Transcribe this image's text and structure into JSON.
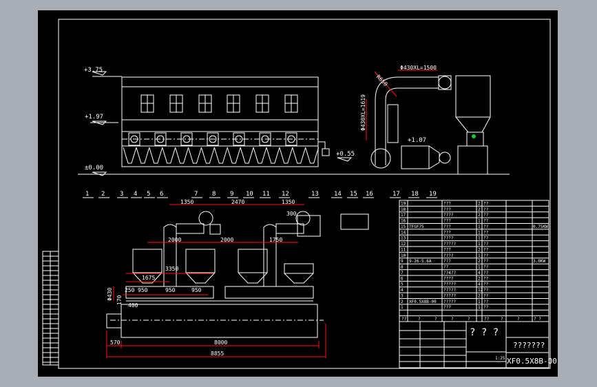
{
  "colors": {
    "background": "#a9adb5",
    "paper": "#000000",
    "line": "#ffffff",
    "dimension": "#ff1010",
    "marker": "#00cc33"
  },
  "elevations": {
    "top": "+3.75",
    "mid": "+1.97",
    "ground": "±0.00",
    "outlet": "+0.55",
    "fan": "+1.07"
  },
  "callouts": [
    "1",
    "2",
    "3",
    "4",
    "5",
    "6",
    "7",
    "8",
    "9",
    "10",
    "11",
    "12",
    "13",
    "14",
    "15",
    "16",
    "17",
    "18",
    "19"
  ],
  "side_view": {
    "duct_h": "Φ430XL=1500",
    "duct_v": "Φ430XL=1619",
    "bend": "R650"
  },
  "plan_dims": {
    "d1350a": "1350",
    "d2470": "2470",
    "d1350b": "1350",
    "d300": "300",
    "d2000a": "2000",
    "d2000b": "2000",
    "d1750": "1750",
    "d3350": "3350",
    "d1675": "1675",
    "d250": "250",
    "d950a": "950",
    "d950b": "950",
    "d950c": "950",
    "d430": "Φ430",
    "d170": "170",
    "d400": "400",
    "d570": "570",
    "d8000": "8000",
    "d8855": "8855"
  },
  "parts_list": [
    {
      "no": "19",
      "code": "",
      "name": "???",
      "qty": "2",
      "mat": "??",
      "note": ""
    },
    {
      "no": "18",
      "code": "",
      "name": "???",
      "qty": "2",
      "mat": "??",
      "note": ""
    },
    {
      "no": "17",
      "code": "",
      "name": "????",
      "qty": "2",
      "mat": "??",
      "note": ""
    },
    {
      "no": "16",
      "code": "",
      "name": "???",
      "qty": "1",
      "mat": "??",
      "note": ""
    },
    {
      "no": "15",
      "code": "TFGF75",
      "name": "???",
      "qty": "1",
      "mat": "??",
      "note": "0.75KW"
    },
    {
      "no": "14",
      "code": "",
      "name": "???",
      "qty": "1",
      "mat": "??",
      "note": ""
    },
    {
      "no": "13",
      "code": "",
      "name": "????",
      "qty": "1",
      "mat": "??",
      "note": ""
    },
    {
      "no": "12",
      "code": "",
      "name": "?????",
      "qty": "1",
      "mat": "??",
      "note": ""
    },
    {
      "no": "11",
      "code": "",
      "name": "???",
      "qty": "2",
      "mat": "??",
      "note": ""
    },
    {
      "no": "10",
      "code": "",
      "name": "????",
      "qty": "1",
      "mat": "??",
      "note": ""
    },
    {
      "no": "9",
      "code": "9-26-5.6A",
      "name": "???",
      "qty": "2",
      "mat": "??",
      "note": "3.0KW"
    },
    {
      "no": "8",
      "code": "",
      "name": "??",
      "qty": "1",
      "mat": "??",
      "note": ""
    },
    {
      "no": "7",
      "code": "",
      "name": "??4??",
      "qty": "4",
      "mat": "??",
      "note": ""
    },
    {
      "no": "6",
      "code": "",
      "name": "????",
      "qty": "2",
      "mat": "??",
      "note": ""
    },
    {
      "no": "5",
      "code": "",
      "name": "?????",
      "qty": "4",
      "mat": "??",
      "note": ""
    },
    {
      "no": "4",
      "code": "",
      "name": "?????",
      "qty": "12",
      "mat": "??",
      "note": ""
    },
    {
      "no": "3",
      "code": "",
      "name": "?????",
      "qty": "2",
      "mat": "??",
      "note": ""
    },
    {
      "no": "2",
      "code": "XF0.5X8B-00",
      "name": "?????",
      "qty": "1",
      "mat": "??",
      "note": ""
    },
    {
      "no": "1",
      "code": "",
      "name": "???",
      "qty": "1",
      "mat": "??",
      "note": ""
    }
  ],
  "parts_header": [
    "??",
    "?",
    "?",
    "?",
    "?",
    "??",
    "?",
    "?",
    "? ?"
  ],
  "title_block": {
    "company": "? ? ?",
    "drawing_name": "???????",
    "drawing_no": "XF0.5X8B-00",
    "scale": "1:25"
  }
}
